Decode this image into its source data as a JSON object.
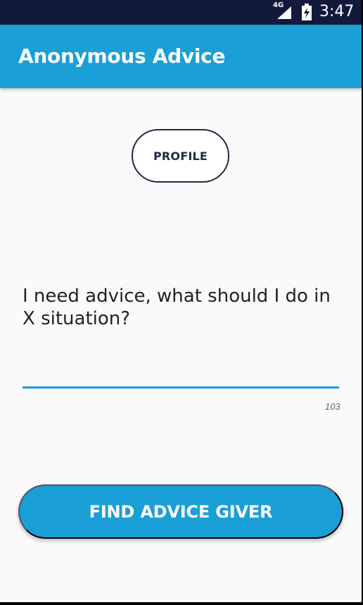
{
  "status_bar": {
    "network_label": "4G",
    "time": "3:47",
    "background_color": "#111a3a",
    "icons": {
      "signal": "cell-signal-icon",
      "battery": "battery-charging-icon"
    }
  },
  "app_bar": {
    "title": "Anonymous Advice",
    "background_color": "#1a9fd7"
  },
  "profile": {
    "label": "PROFILE"
  },
  "question": {
    "text": "I need advice, what should I do in X situation?"
  },
  "answer": {
    "character_count": "103",
    "underline_color": "#1a9fd7"
  },
  "find_button": {
    "label": "FIND ADVICE GIVER",
    "color": "#1a9fd7"
  }
}
